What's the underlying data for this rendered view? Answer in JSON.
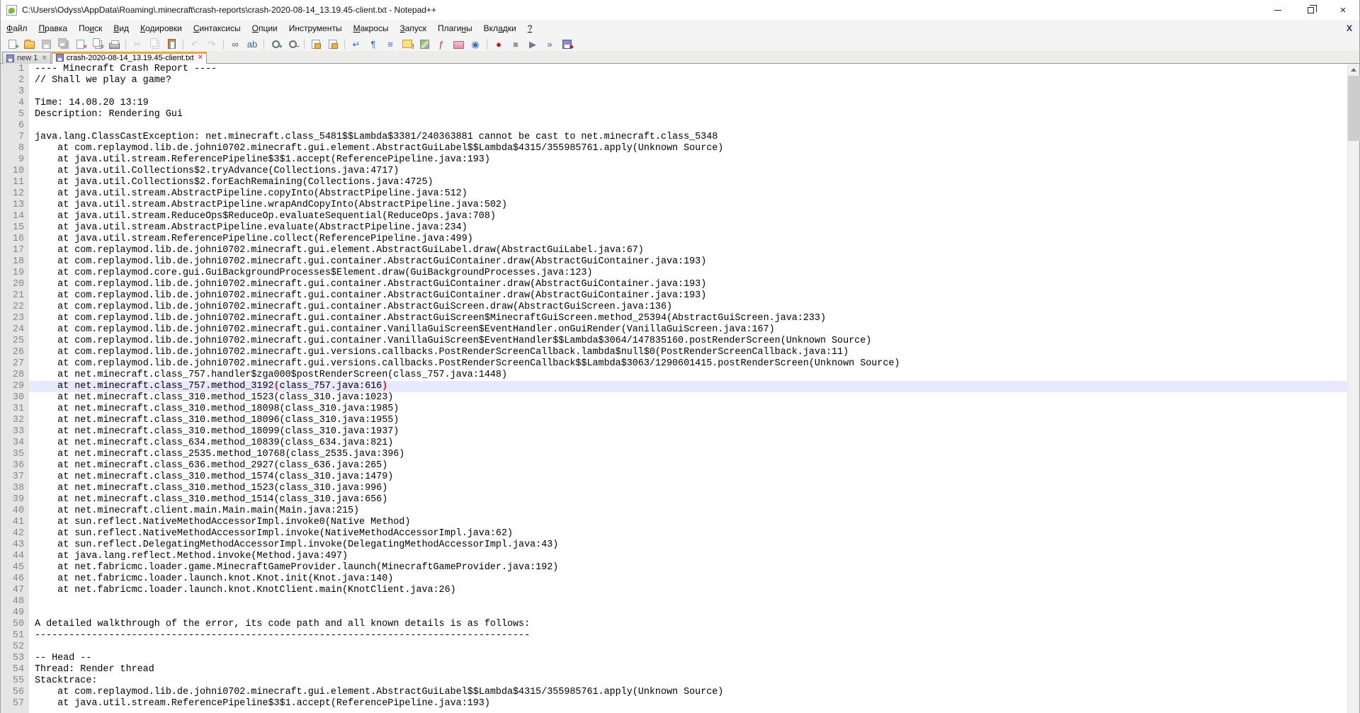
{
  "colors": {
    "active_tab_accent": "#f3a43b",
    "caret_line_bg": "#e8e8ff",
    "brace_match": "#d42020",
    "gutter_bg": "#e5e5e5",
    "gutter_text": "#858585"
  },
  "window": {
    "title": "C:\\Users\\Odyss\\AppData\\Roaming\\.minecraft\\crash-reports\\crash-2020-08-14_13.19.45-client.txt - Notepad++"
  },
  "menu": {
    "doc_close_glyph": "X",
    "items": [
      {
        "id": "file",
        "label": "Файл",
        "u": 0
      },
      {
        "id": "edit",
        "label": "Правка",
        "u": 0
      },
      {
        "id": "search",
        "label": "Поиск",
        "u": 2
      },
      {
        "id": "view",
        "label": "Вид",
        "u": 0
      },
      {
        "id": "encoding",
        "label": "Кодировки",
        "u": 0
      },
      {
        "id": "language",
        "label": "Синтаксисы",
        "u": 0
      },
      {
        "id": "settings",
        "label": "Опции",
        "u": 0
      },
      {
        "id": "tools",
        "label": "Инструменты",
        "u": -1
      },
      {
        "id": "macro",
        "label": "Макросы",
        "u": 0
      },
      {
        "id": "run",
        "label": "Запуск",
        "u": 0
      },
      {
        "id": "plugins",
        "label": "Плагины",
        "u": 5
      },
      {
        "id": "tabs",
        "label": "Вкладки",
        "u": 3
      },
      {
        "id": "help",
        "label": "?",
        "u": 0
      }
    ]
  },
  "toolbar": {
    "buttons": [
      {
        "name": "new-file",
        "shape": "page",
        "glyph": "+",
        "color": "#1f9f1f"
      },
      {
        "name": "open-file",
        "shape": "folder"
      },
      {
        "name": "save-file",
        "shape": "floppy",
        "disabled": true
      },
      {
        "name": "save-all",
        "shape": "floppy2",
        "disabled": true
      },
      {
        "name": "close-file",
        "shape": "page",
        "glyph": "×",
        "color": "#d85040"
      },
      {
        "name": "close-all",
        "shape": "page2",
        "glyph": "×",
        "color": "#d85040"
      },
      {
        "name": "print",
        "shape": "printer"
      },
      {
        "sep": true
      },
      {
        "name": "cut",
        "shape": "none",
        "glyph": "✂",
        "color": "#8a8a8a",
        "disabled": true
      },
      {
        "name": "copy",
        "shape": "page2",
        "disabled": true
      },
      {
        "name": "paste",
        "shape": "paste"
      },
      {
        "sep": true
      },
      {
        "name": "undo",
        "shape": "none",
        "glyph": "↶",
        "color": "#9a9a9a",
        "disabled": true
      },
      {
        "name": "redo",
        "shape": "none",
        "glyph": "↷",
        "color": "#9a9a9a",
        "disabled": true
      },
      {
        "sep": true
      },
      {
        "name": "find",
        "shape": "none",
        "glyph": "∞",
        "color": "#6b5b45"
      },
      {
        "name": "replace",
        "shape": "none",
        "glyph": "ab",
        "color": "#2f62b8"
      },
      {
        "sep": true
      },
      {
        "name": "zoom-in",
        "shape": "circle",
        "glyph": "+",
        "color": "#1f9f1f"
      },
      {
        "name": "zoom-out",
        "shape": "circle",
        "glyph": "−",
        "color": "#d85040"
      },
      {
        "sep": true
      },
      {
        "name": "sync-scroll-vertical",
        "shape": "pagelock"
      },
      {
        "name": "sync-scroll-horizontal",
        "shape": "pagelock"
      },
      {
        "sep": true
      },
      {
        "name": "word-wrap",
        "shape": "none",
        "glyph": "↵",
        "color": "#3a6ebf"
      },
      {
        "name": "show-all-characters",
        "shape": "none",
        "glyph": "¶",
        "color": "#3a6ebf"
      },
      {
        "name": "show-indent-guide",
        "shape": "none",
        "glyph": "≡",
        "color": "#3a6ebf"
      },
      {
        "name": "user-defined-dialog",
        "shape": "yellow",
        "glyph": "!",
        "color": "#a07000"
      },
      {
        "name": "document-map",
        "shape": "map"
      },
      {
        "name": "function-list",
        "shape": "none",
        "glyph": "ƒ",
        "color": "#c23030"
      },
      {
        "name": "folder-as-workspace",
        "shape": "folderpink"
      },
      {
        "name": "document-monitor",
        "shape": "none",
        "glyph": "◉",
        "color": "#3a6ebf"
      },
      {
        "sep": true
      },
      {
        "name": "macro-record",
        "shape": "none",
        "glyph": "●",
        "color": "#cc1111"
      },
      {
        "name": "macro-stop",
        "shape": "none",
        "glyph": "■",
        "color": "#9a9a9a"
      },
      {
        "name": "macro-play",
        "shape": "none",
        "glyph": "▶",
        "color": "#6a7a8a"
      },
      {
        "name": "macro-run-multiple",
        "shape": "none",
        "glyph": "»",
        "color": "#2f62b8"
      },
      {
        "name": "macro-save",
        "shape": "floppy",
        "glyph": "●",
        "color": "#cc1111"
      }
    ]
  },
  "tabs": {
    "items": [
      {
        "label": "new 1",
        "active": false,
        "saved": true
      },
      {
        "label": "crash-2020-08-14_13.19.45-client.txt",
        "active": true,
        "saved": true
      }
    ]
  },
  "editor": {
    "caret_line": 29,
    "lines": [
      "---- Minecraft Crash Report ----",
      "// Shall we play a game?",
      "",
      "Time: 14.08.20 13:19",
      "Description: Rendering Gui",
      "",
      "java.lang.ClassCastException: net.minecraft.class_5481$$Lambda$3381/240363881 cannot be cast to net.minecraft.class_5348",
      "\tat com.replaymod.lib.de.johni0702.minecraft.gui.element.AbstractGuiLabel$$Lambda$4315/355985761.apply(Unknown Source)",
      "\tat java.util.stream.ReferencePipeline$3$1.accept(ReferencePipeline.java:193)",
      "\tat java.util.Collections$2.tryAdvance(Collections.java:4717)",
      "\tat java.util.Collections$2.forEachRemaining(Collections.java:4725)",
      "\tat java.util.stream.AbstractPipeline.copyInto(AbstractPipeline.java:512)",
      "\tat java.util.stream.AbstractPipeline.wrapAndCopyInto(AbstractPipeline.java:502)",
      "\tat java.util.stream.ReduceOps$ReduceOp.evaluateSequential(ReduceOps.java:708)",
      "\tat java.util.stream.AbstractPipeline.evaluate(AbstractPipeline.java:234)",
      "\tat java.util.stream.ReferencePipeline.collect(ReferencePipeline.java:499)",
      "\tat com.replaymod.lib.de.johni0702.minecraft.gui.element.AbstractGuiLabel.draw(AbstractGuiLabel.java:67)",
      "\tat com.replaymod.lib.de.johni0702.minecraft.gui.container.AbstractGuiContainer.draw(AbstractGuiContainer.java:193)",
      "\tat com.replaymod.core.gui.GuiBackgroundProcesses$Element.draw(GuiBackgroundProcesses.java:123)",
      "\tat com.replaymod.lib.de.johni0702.minecraft.gui.container.AbstractGuiContainer.draw(AbstractGuiContainer.java:193)",
      "\tat com.replaymod.lib.de.johni0702.minecraft.gui.container.AbstractGuiContainer.draw(AbstractGuiContainer.java:193)",
      "\tat com.replaymod.lib.de.johni0702.minecraft.gui.container.AbstractGuiScreen.draw(AbstractGuiScreen.java:136)",
      "\tat com.replaymod.lib.de.johni0702.minecraft.gui.container.AbstractGuiScreen$MinecraftGuiScreen.method_25394(AbstractGuiScreen.java:233)",
      "\tat com.replaymod.lib.de.johni0702.minecraft.gui.container.VanillaGuiScreen$EventHandler.onGuiRender(VanillaGuiScreen.java:167)",
      "\tat com.replaymod.lib.de.johni0702.minecraft.gui.container.VanillaGuiScreen$EventHandler$$Lambda$3064/147835160.postRenderScreen(Unknown Source)",
      "\tat com.replaymod.lib.de.johni0702.minecraft.gui.versions.callbacks.PostRenderScreenCallback.lambda$null$0(PostRenderScreenCallback.java:11)",
      "\tat com.replaymod.lib.de.johni0702.minecraft.gui.versions.callbacks.PostRenderScreenCallback$$Lambda$3063/1290601415.postRenderScreen(Unknown Source)",
      "\tat net.minecraft.class_757.handler$zga000$postRenderScreen(class_757.java:1448)",
      "\tat net.minecraft.class_757.method_3192(class_757.java:616)",
      "\tat net.minecraft.class_310.method_1523(class_310.java:1023)",
      "\tat net.minecraft.class_310.method_18098(class_310.java:1985)",
      "\tat net.minecraft.class_310.method_18096(class_310.java:1955)",
      "\tat net.minecraft.class_310.method_18099(class_310.java:1937)",
      "\tat net.minecraft.class_634.method_10839(class_634.java:821)",
      "\tat net.minecraft.class_2535.method_10768(class_2535.java:396)",
      "\tat net.minecraft.class_636.method_2927(class_636.java:265)",
      "\tat net.minecraft.class_310.method_1574(class_310.java:1479)",
      "\tat net.minecraft.class_310.method_1523(class_310.java:996)",
      "\tat net.minecraft.class_310.method_1514(class_310.java:656)",
      "\tat net.minecraft.client.main.Main.main(Main.java:215)",
      "\tat sun.reflect.NativeMethodAccessorImpl.invoke0(Native Method)",
      "\tat sun.reflect.NativeMethodAccessorImpl.invoke(NativeMethodAccessorImpl.java:62)",
      "\tat sun.reflect.DelegatingMethodAccessorImpl.invoke(DelegatingMethodAccessorImpl.java:43)",
      "\tat java.lang.reflect.Method.invoke(Method.java:497)",
      "\tat net.fabricmc.loader.game.MinecraftGameProvider.launch(MinecraftGameProvider.java:192)",
      "\tat net.fabricmc.loader.launch.knot.Knot.init(Knot.java:140)",
      "\tat net.fabricmc.loader.launch.knot.KnotClient.main(KnotClient.java:26)",
      "",
      "",
      "A detailed walkthrough of the error, its code path and all known details is as follows:",
      "---------------------------------------------------------------------------------------",
      "",
      "-- Head --",
      "Thread: Render thread",
      "Stacktrace:",
      "\tat com.replaymod.lib.de.johni0702.minecraft.gui.element.AbstractGuiLabel$$Lambda$4315/355985761.apply(Unknown Source)",
      "\tat java.util.stream.ReferencePipeline$3$1.accept(ReferencePipeline.java:193)"
    ]
  }
}
